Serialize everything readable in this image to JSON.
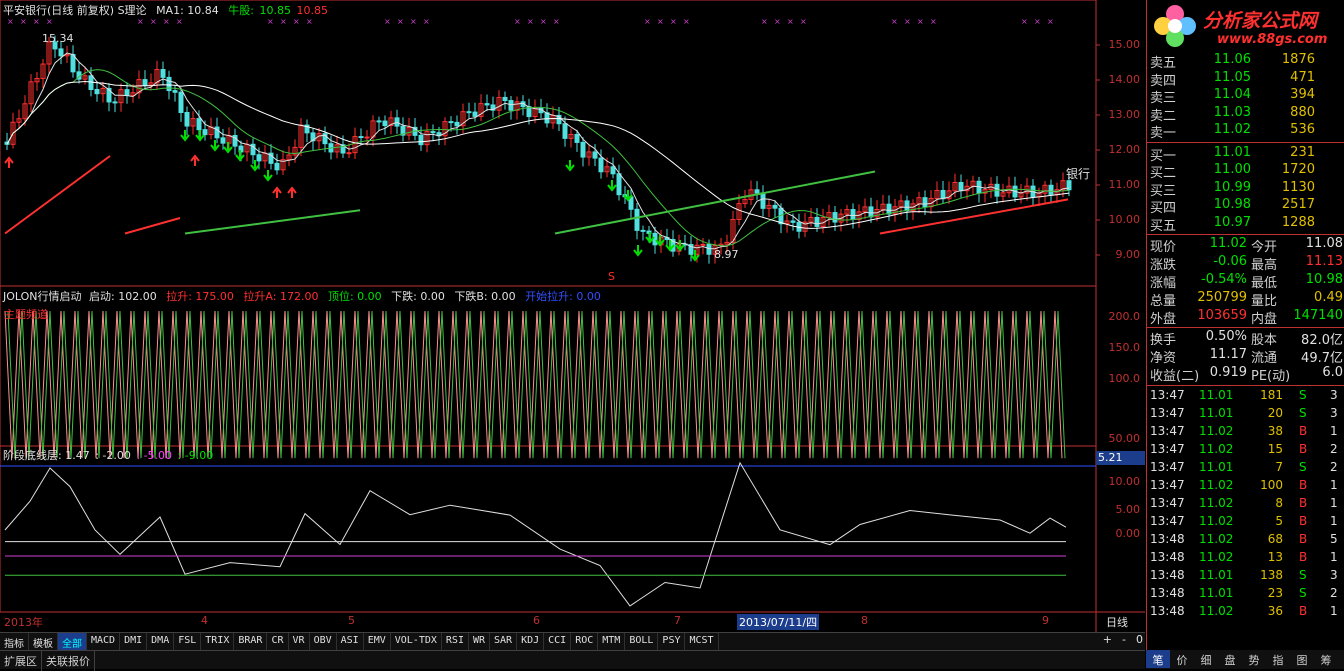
{
  "header": {
    "title": "平安银行(日线 前复权) S理论",
    "ma1": "MA1: 10.84",
    "bull_label": "牛股:",
    "bull_v1": "10.85",
    "bull_v2": "10.85"
  },
  "price_axis": [
    "15.00",
    "14.00",
    "13.00",
    "12.00",
    "11.00",
    "10.00",
    "9.00"
  ],
  "price_annotations": {
    "high": "15.34",
    "low": "8.97",
    "stock_tag": "银行",
    "buy": "买",
    "s_mark": "S"
  },
  "ind1": {
    "name": "JOLON行情启动",
    "qidong": "启动: 102.00",
    "lashen": "拉升: 175.00",
    "lashenA": "拉升A: 172.00",
    "dingwei": "顶位: 0.00",
    "xiadie": "下跌: 0.00",
    "xiadieB": "下跌B: 0.00",
    "kaishi": "开始拉升: 0.00",
    "overlay": "主题频道",
    "axis": [
      "200.0",
      "150.0",
      "100.0",
      "50.00"
    ],
    "readout": "5.21"
  },
  "ind2": {
    "name": "阶段底线层",
    "values": "阶段底线层: 1.47",
    "v2": ": -2.00",
    "v3": ": -5.00",
    "v4": ": -9.00",
    "axis": [
      "10.00",
      "5.00",
      "0.00"
    ]
  },
  "date_axis": {
    "labels": [
      "2013年",
      "4",
      "5",
      "6",
      "7",
      "8",
      "9"
    ],
    "cursor_date": "2013/07/11/四",
    "period": "日线"
  },
  "tabs": [
    "指标",
    "模板",
    "全部",
    "MACD",
    "DMI",
    "DMA",
    "FSL",
    "TRIX",
    "BRAR",
    "CR",
    "VR",
    "OBV",
    "ASI",
    "EMV",
    "VOL-TDX",
    "RSI",
    "WR",
    "SAR",
    "KDJ",
    "CCI",
    "ROC",
    "MTM",
    "BOLL",
    "PSY",
    "MCST"
  ],
  "zoom_btns": [
    "+",
    "-",
    "0"
  ],
  "status_buttons": [
    "扩展区",
    "关联报价"
  ],
  "logo": {
    "title": "分析家公式网",
    "url": "www.88gs.com"
  },
  "orderbook": {
    "asks": [
      {
        "label": "卖五",
        "price": "11.06",
        "vol": "1876"
      },
      {
        "label": "卖四",
        "price": "11.05",
        "vol": "471"
      },
      {
        "label": "卖三",
        "price": "11.04",
        "vol": "394"
      },
      {
        "label": "卖二",
        "price": "11.03",
        "vol": "880"
      },
      {
        "label": "卖一",
        "price": "11.02",
        "vol": "536"
      }
    ],
    "bids": [
      {
        "label": "买一",
        "price": "11.01",
        "vol": "231"
      },
      {
        "label": "买二",
        "price": "11.00",
        "vol": "1720"
      },
      {
        "label": "买三",
        "price": "10.99",
        "vol": "1130"
      },
      {
        "label": "买四",
        "price": "10.98",
        "vol": "2517"
      },
      {
        "label": "买五",
        "price": "10.97",
        "vol": "1288"
      }
    ]
  },
  "stats": [
    {
      "l1": "现价",
      "v1": "11.02",
      "l2": "今开",
      "v2": "11.08",
      "c1": "green",
      "c2": "white"
    },
    {
      "l1": "涨跌",
      "v1": "-0.06",
      "l2": "最高",
      "v2": "11.13",
      "c1": "green",
      "c2": "red"
    },
    {
      "l1": "涨幅",
      "v1": "-0.54%",
      "l2": "最低",
      "v2": "10.98",
      "c1": "green",
      "c2": "green"
    },
    {
      "l1": "总量",
      "v1": "250799",
      "l2": "量比",
      "v2": "0.49",
      "c1": "yellow",
      "c2": "yellow"
    },
    {
      "l1": "外盘",
      "v1": "103659",
      "l2": "内盘",
      "v2": "147140",
      "c1": "red",
      "c2": "green"
    },
    {
      "l1": "换手",
      "v1": "0.50%",
      "l2": "股本",
      "v2": "82.0亿",
      "c1": "white",
      "c2": "white"
    },
    {
      "l1": "净资",
      "v1": "11.17",
      "l2": "流通",
      "v2": "49.7亿",
      "c1": "white",
      "c2": "white"
    },
    {
      "l1": "收益(二)",
      "v1": "0.919",
      "l2": "PE(动)",
      "v2": "6.0",
      "c1": "white",
      "c2": "white"
    }
  ],
  "ticks": [
    {
      "t": "13:47",
      "p": "11.01",
      "v": "181",
      "s": "S",
      "n": "3"
    },
    {
      "t": "13:47",
      "p": "11.01",
      "v": "20",
      "s": "S",
      "n": "3"
    },
    {
      "t": "13:47",
      "p": "11.02",
      "v": "38",
      "s": "B",
      "n": "1"
    },
    {
      "t": "13:47",
      "p": "11.02",
      "v": "15",
      "s": "B",
      "n": "2"
    },
    {
      "t": "13:47",
      "p": "11.01",
      "v": "7",
      "s": "S",
      "n": "2"
    },
    {
      "t": "13:47",
      "p": "11.02",
      "v": "100",
      "s": "B",
      "n": "1"
    },
    {
      "t": "13:47",
      "p": "11.02",
      "v": "8",
      "s": "B",
      "n": "1"
    },
    {
      "t": "13:47",
      "p": "11.02",
      "v": "5",
      "s": "B",
      "n": "1"
    },
    {
      "t": "13:48",
      "p": "11.02",
      "v": "68",
      "s": "B",
      "n": "5"
    },
    {
      "t": "13:48",
      "p": "11.02",
      "v": "13",
      "s": "B",
      "n": "1"
    },
    {
      "t": "13:48",
      "p": "11.01",
      "v": "138",
      "s": "S",
      "n": "3"
    },
    {
      "t": "13:48",
      "p": "11.01",
      "v": "23",
      "s": "S",
      "n": "2"
    },
    {
      "t": "13:48",
      "p": "11.02",
      "v": "36",
      "s": "B",
      "n": "1"
    }
  ],
  "bottom_tabs": [
    "笔",
    "价",
    "细",
    "盘",
    "势",
    "指",
    "图",
    "筹"
  ]
}
